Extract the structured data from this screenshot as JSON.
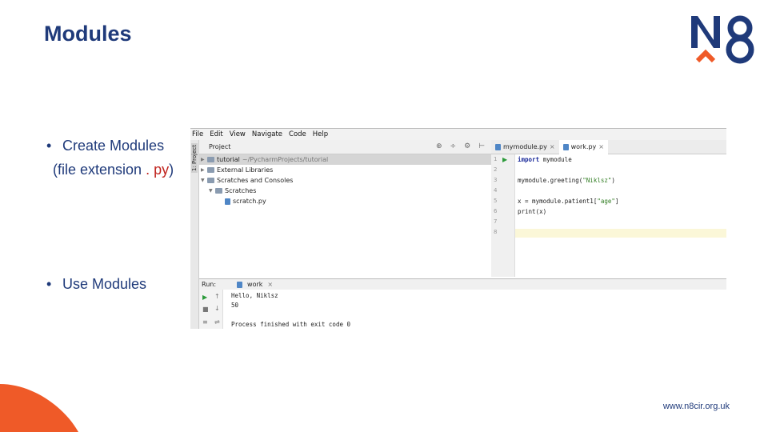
{
  "slide": {
    "title": "Modules",
    "bullets": [
      {
        "text": "Create Modules",
        "sub_prefix": "(file extension ",
        "sub_highlight": ". py",
        "sub_suffix": ")"
      },
      {
        "text": "Use Modules"
      }
    ],
    "bullet_symbol": "•",
    "footer_url": "www.n8cir.org.uk",
    "brand_colors": {
      "navy": "#1f3a7a",
      "orange": "#ef5a28",
      "red": "#c0241f"
    }
  },
  "ide": {
    "menu": [
      "File",
      "Edit",
      "View",
      "Navigate",
      "Code",
      "Help"
    ],
    "side_tab": "1: Project",
    "project_panel": {
      "title": "Project",
      "tools": [
        "⊕",
        "÷",
        "⚙",
        "⊢"
      ]
    },
    "tree": [
      {
        "name": "tutorial",
        "path": "~/PycharmProjects/tutorial",
        "type": "folder",
        "selected": true
      },
      {
        "name": "External Libraries",
        "type": "folder"
      },
      {
        "name": "Scratches and Consoles",
        "type": "folder"
      },
      {
        "name": "Scratches",
        "type": "folder"
      },
      {
        "name": "scratch.py",
        "type": "file"
      }
    ],
    "editor_tabs": [
      {
        "label": "mymodule.py",
        "close": "×",
        "active": false
      },
      {
        "label": "work.py",
        "close": "×",
        "active": true
      }
    ],
    "line_numbers": [
      "1",
      "2",
      "3",
      "4",
      "5",
      "6",
      "7",
      "8"
    ],
    "code": {
      "l1_kw": "import",
      "l1_rest": " mymodule",
      "l3_a": "mymodule.greeting(",
      "l3_str": "\"Niklsz\"",
      "l3_b": ")",
      "l5_a": "x = mymodule.patient1[",
      "l5_str": "\"age\"",
      "l5_b": "]",
      "l6": "print(x)"
    },
    "run": {
      "label": "Run:",
      "tab": "work",
      "close": "×",
      "output": [
        "Hello, Niklsz",
        "50",
        "",
        "Process finished with exit code 0"
      ]
    }
  }
}
